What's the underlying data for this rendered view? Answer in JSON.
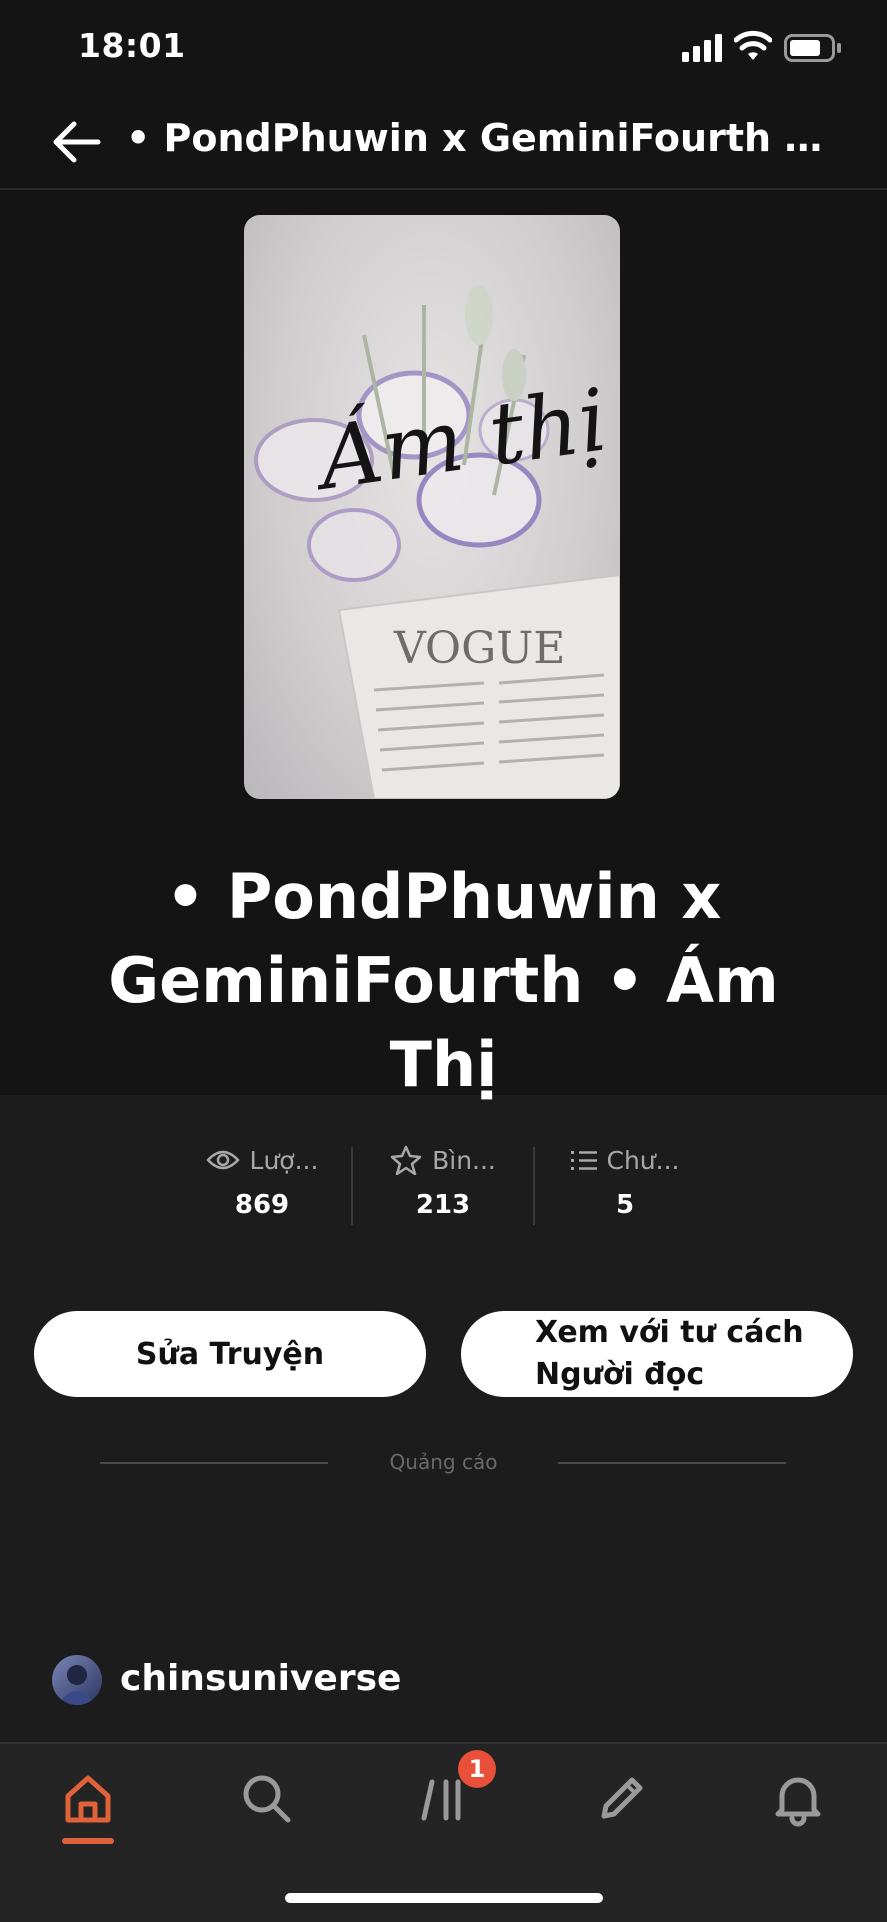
{
  "status_bar": {
    "time": "18:01"
  },
  "header": {
    "title": "• PondPhuwin x GeminiFourth • Ám..."
  },
  "cover": {
    "script_title": "Ám thị",
    "magazine": "VOGUE"
  },
  "book": {
    "title": "• PondPhuwin x GeminiFourth • Ám Thị"
  },
  "stats": [
    {
      "label": "Lượ...",
      "value": "869",
      "icon": "eye-icon"
    },
    {
      "label": "Bìn...",
      "value": "213",
      "icon": "star-icon"
    },
    {
      "label": "Chư...",
      "value": "5",
      "icon": "list-icon"
    }
  ],
  "actions": {
    "edit_label": "Sửa Truyện",
    "reader_label_1": "Xem với tư cách",
    "reader_label_2": "Người đọc"
  },
  "ad": {
    "label": "Quảng cáo"
  },
  "author": {
    "name": "chinsuniverse"
  },
  "tabbar": {
    "items": [
      "home-icon",
      "search-icon",
      "library-icon",
      "pencil-icon",
      "bell-icon"
    ],
    "active": "home-icon",
    "badge": "1",
    "accent": "#e0623a"
  }
}
